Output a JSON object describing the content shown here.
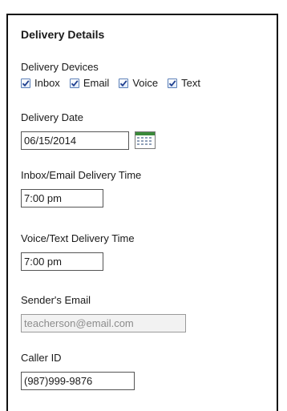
{
  "section_title": "Delivery Details",
  "devices": {
    "label": "Delivery Devices",
    "options": [
      {
        "label": "Inbox",
        "checked": true
      },
      {
        "label": "Email",
        "checked": true
      },
      {
        "label": "Voice",
        "checked": true
      },
      {
        "label": "Text",
        "checked": true
      }
    ]
  },
  "delivery_date": {
    "label": "Delivery Date",
    "value": "06/15/2014",
    "icon": "calendar-icon"
  },
  "inbox_email_time": {
    "label": "Inbox/Email Delivery Time",
    "value": "7:00 pm"
  },
  "voice_text_time": {
    "label": "Voice/Text Delivery Time",
    "value": "7:00 pm"
  },
  "sender_email": {
    "label": "Sender's Email",
    "value": "teacherson@email.com",
    "disabled": true
  },
  "caller_id": {
    "label": "Caller ID",
    "value": "(987)999-9876"
  },
  "colors": {
    "checkbox_border": "#5a7fb8",
    "checkmark": "#1f3f8f",
    "calendar_header": "#3a8a3a"
  }
}
